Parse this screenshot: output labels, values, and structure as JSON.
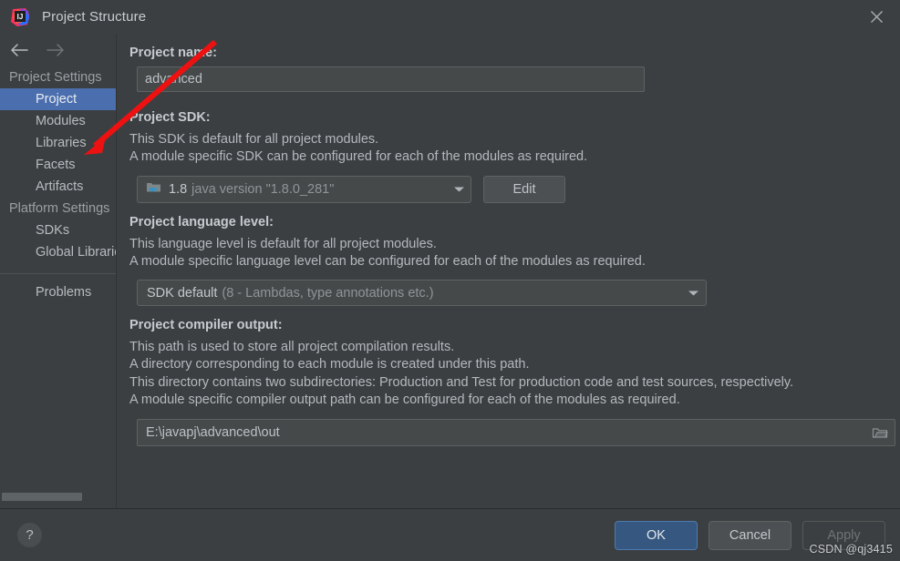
{
  "window": {
    "title": "Project Structure",
    "app_icon": "intellij-idea-logo",
    "close_icon": "close-icon"
  },
  "sidebar": {
    "nav": {
      "back_icon": "arrow-left-icon",
      "forward_icon": "arrow-right-icon"
    },
    "groups": [
      {
        "label": "Project Settings",
        "items": [
          {
            "label": "Project",
            "selected": true
          },
          {
            "label": "Modules",
            "selected": false
          },
          {
            "label": "Libraries",
            "selected": false
          },
          {
            "label": "Facets",
            "selected": false
          },
          {
            "label": "Artifacts",
            "selected": false
          }
        ]
      },
      {
        "label": "Platform Settings",
        "items": [
          {
            "label": "SDKs",
            "selected": false
          },
          {
            "label": "Global Libraries",
            "selected": false
          }
        ]
      }
    ],
    "problems": {
      "label": "Problems"
    }
  },
  "main": {
    "project_name": {
      "label": "Project name:",
      "value": "advanced"
    },
    "project_sdk": {
      "label": "Project SDK:",
      "description_line_1": "This SDK is default for all project modules.",
      "description_line_2": "A module specific SDK can be configured for each of the modules as required.",
      "sdk_icon": "java-sdk-folder-icon",
      "sdk_version": "1.8",
      "sdk_description": "java version \"1.8.0_281\"",
      "dropdown_icon": "chevron-down-icon",
      "edit_button": "Edit"
    },
    "language_level": {
      "label": "Project language level:",
      "description_line_1": "This language level is default for all project modules.",
      "description_line_2": "A module specific language level can be configured for each of the modules as required.",
      "selected": "SDK default",
      "selected_detail": "(8 - Lambdas, type annotations etc.)",
      "dropdown_icon": "chevron-down-icon"
    },
    "compiler_output": {
      "label": "Project compiler output:",
      "description_line_1": "This path is used to store all project compilation results.",
      "description_line_2": "A directory corresponding to each module is created under this path.",
      "description_line_3": "This directory contains two subdirectories: Production and Test for production code and test sources, respectively.",
      "description_line_4": "A module specific compiler output path can be configured for each of the modules as required.",
      "value": "E:\\javapj\\advanced\\out",
      "browse_icon": "folder-browse-icon"
    }
  },
  "footer": {
    "help_icon": "?",
    "ok_label": "OK",
    "cancel_label": "Cancel",
    "apply_label": "Apply"
  },
  "annotation": {
    "arrow_color": "#ee1111",
    "points_to": "Libraries"
  },
  "watermark": {
    "text": "CSDN @qj3415"
  },
  "colors": {
    "accent": "#4b6eaf",
    "primary_button": "#365880",
    "background": "#3c3f41",
    "field_background": "#45494a"
  }
}
